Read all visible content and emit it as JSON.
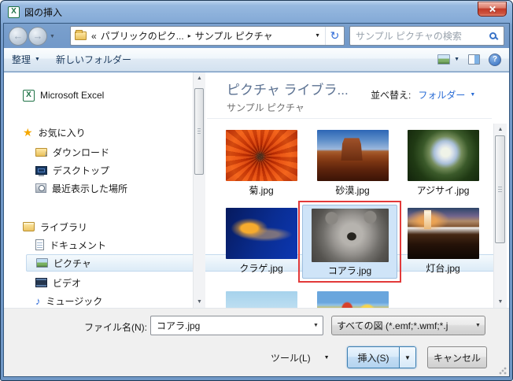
{
  "window": {
    "title": "図の挿入"
  },
  "nav": {
    "breadcrumb_overflow": "«",
    "crumb_parent": "パブリックのピク...",
    "crumb_current": "サンプル ピクチャ"
  },
  "search": {
    "placeholder": "サンプル ピクチャの検索"
  },
  "toolbar": {
    "organize_label": "整理",
    "new_folder_label": "新しいフォルダー"
  },
  "sidebar": {
    "items": [
      {
        "label": "Microsoft Excel"
      },
      {
        "label": "お気に入り"
      },
      {
        "label": "ダウンロード"
      },
      {
        "label": "デスクトップ"
      },
      {
        "label": "最近表示した場所"
      },
      {
        "label": "ライブラリ"
      },
      {
        "label": "ドキュメント"
      },
      {
        "label": "ピクチャ",
        "selected": true
      },
      {
        "label": "ビデオ"
      },
      {
        "label": "ミュージック"
      }
    ]
  },
  "main": {
    "library_title": "ピクチャ ライブラ...",
    "library_subtitle": "サンプル ピクチャ",
    "sort_label": "並べ替え:",
    "sort_value": "フォルダー",
    "files": [
      {
        "label": "菊.jpg",
        "thumb": "chrysanthemum"
      },
      {
        "label": "砂漠.jpg",
        "thumb": "desert"
      },
      {
        "label": "アジサイ.jpg",
        "thumb": "hydrangea"
      },
      {
        "label": "クラゲ.jpg",
        "thumb": "jellyfish"
      },
      {
        "label": "コアラ.jpg",
        "thumb": "koala",
        "selected": true
      },
      {
        "label": "灯台.jpg",
        "thumb": "lighthouse"
      },
      {
        "label": "",
        "thumb": "penguins"
      },
      {
        "label": "",
        "thumb": "tulips"
      }
    ]
  },
  "footer": {
    "filename_label": "ファイル名(N):",
    "filename_value": "コアラ.jpg",
    "filetype_value": "すべての図 (*.emf;*.wmf;*.j",
    "tools_label": "ツール(L)",
    "insert_label": "挿入(S)",
    "cancel_label": "キャンセル"
  },
  "colors": {
    "titlebar_blue": "#7ea4d2",
    "selection_fill": "#cfe4f8",
    "selection_border": "#9ebfdf",
    "annotation_red": "#e23a3a",
    "link_blue": "#2a6cd5",
    "insert_button_border": "#3c7fb1"
  }
}
